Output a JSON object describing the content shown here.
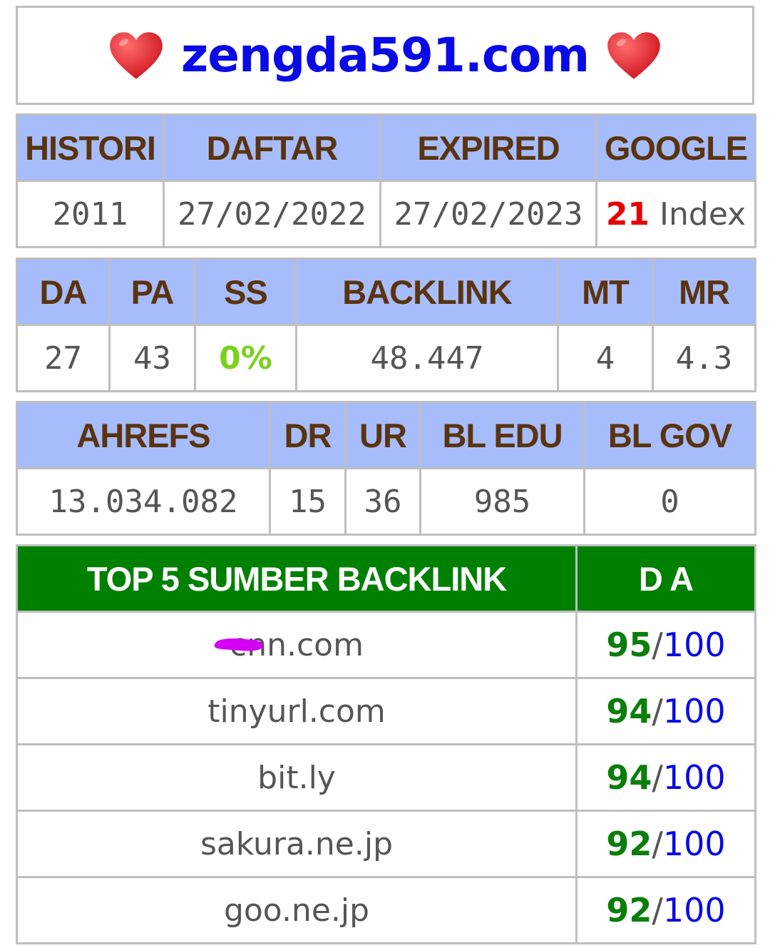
{
  "header": {
    "domain": "zengda591.com",
    "left_icon": "heart-icon",
    "right_icon": "heart-icon",
    "heart_color": "#e8202c"
  },
  "info": {
    "headers": [
      "HISTORI",
      "DAFTAR",
      "EXPIRED",
      "GOOGLE"
    ],
    "histori": "2011",
    "daftar": "27/02/2022",
    "expired": "27/02/2023",
    "google_count": "21",
    "google_label": "Index"
  },
  "moz": {
    "headers": [
      "DA",
      "PA",
      "SS",
      "BACKLINK",
      "MT",
      "MR"
    ],
    "da": "27",
    "pa": "43",
    "ss": "0%",
    "backlink": "48.447",
    "mt": "4",
    "mr": "4.3"
  },
  "ahrefs": {
    "headers": [
      "AHREFS",
      "DR",
      "UR",
      "BL EDU",
      "BL GOV"
    ],
    "ahrefs": "13.034.082",
    "dr": "15",
    "ur": "36",
    "bl_edu": "985",
    "bl_gov": "0"
  },
  "top_sources": {
    "title": "TOP 5 SUMBER BACKLINK",
    "da_header": "D A",
    "separator": "/",
    "rows": [
      {
        "site": "cnn.com",
        "score": "95",
        "max": "100"
      },
      {
        "site": "tinyurl.com",
        "score": "94",
        "max": "100"
      },
      {
        "site": "bit.ly",
        "score": "94",
        "max": "100"
      },
      {
        "site": "sakura.ne.jp",
        "score": "92",
        "max": "100"
      },
      {
        "site": "goo.ne.jp",
        "score": "92",
        "max": "100"
      }
    ]
  },
  "colors": {
    "header_bg": "#a7bcfb",
    "header_text": "#5a3410",
    "title_blue": "#0a0ae6",
    "green_header": "#008000",
    "scribble": "#d400f5"
  }
}
